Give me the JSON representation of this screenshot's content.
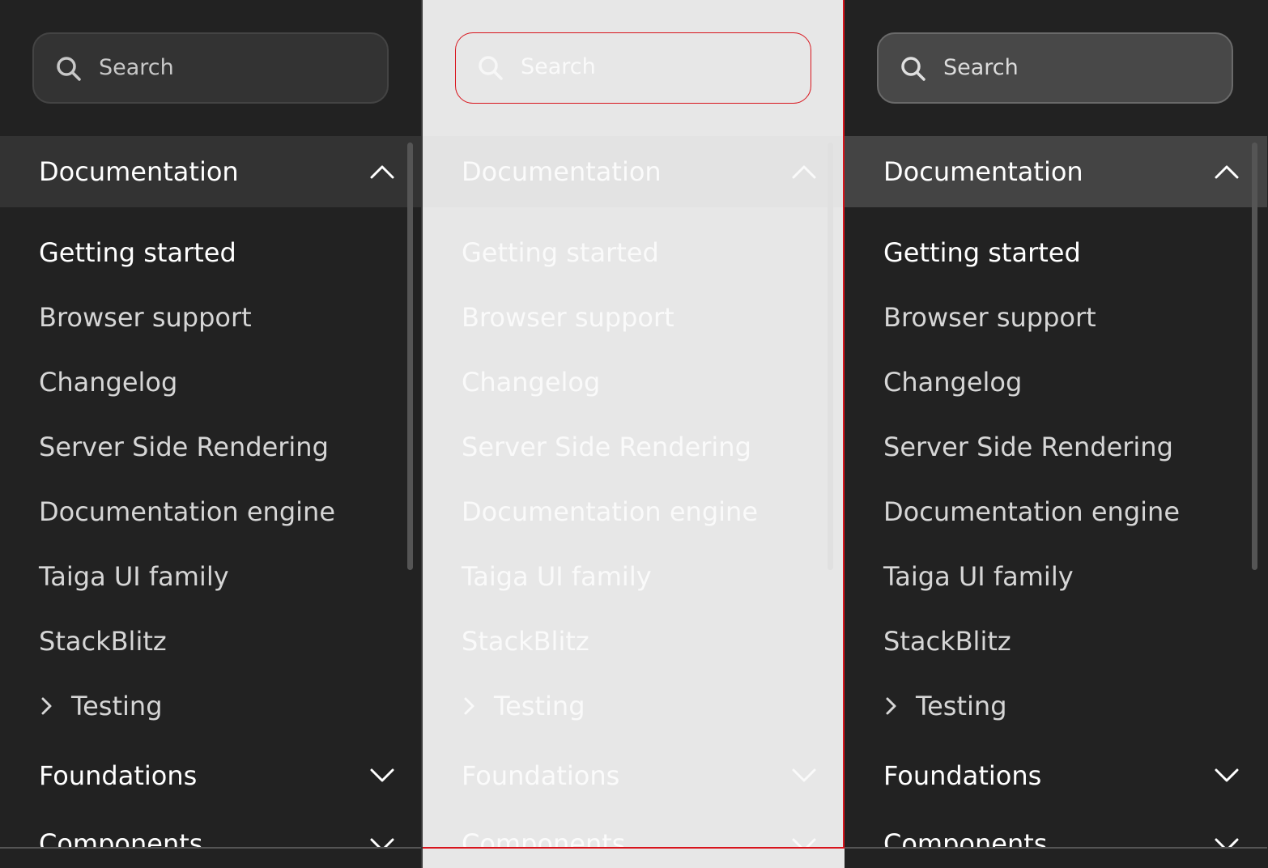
{
  "search": {
    "label": "Search"
  },
  "nav": {
    "section_title": "Documentation",
    "items": [
      {
        "label": "Getting started"
      },
      {
        "label": "Browser support"
      },
      {
        "label": "Changelog"
      },
      {
        "label": "Server Side Rendering"
      },
      {
        "label": "Documentation engine"
      },
      {
        "label": "Taiga UI family"
      },
      {
        "label": "StackBlitz"
      }
    ],
    "testing": "Testing",
    "foundations": "Foundations",
    "components": "Components"
  },
  "colors": {
    "dark_bg": "#222222",
    "light_bg": "#e7e7e7",
    "accent_red": "#d8141c"
  }
}
